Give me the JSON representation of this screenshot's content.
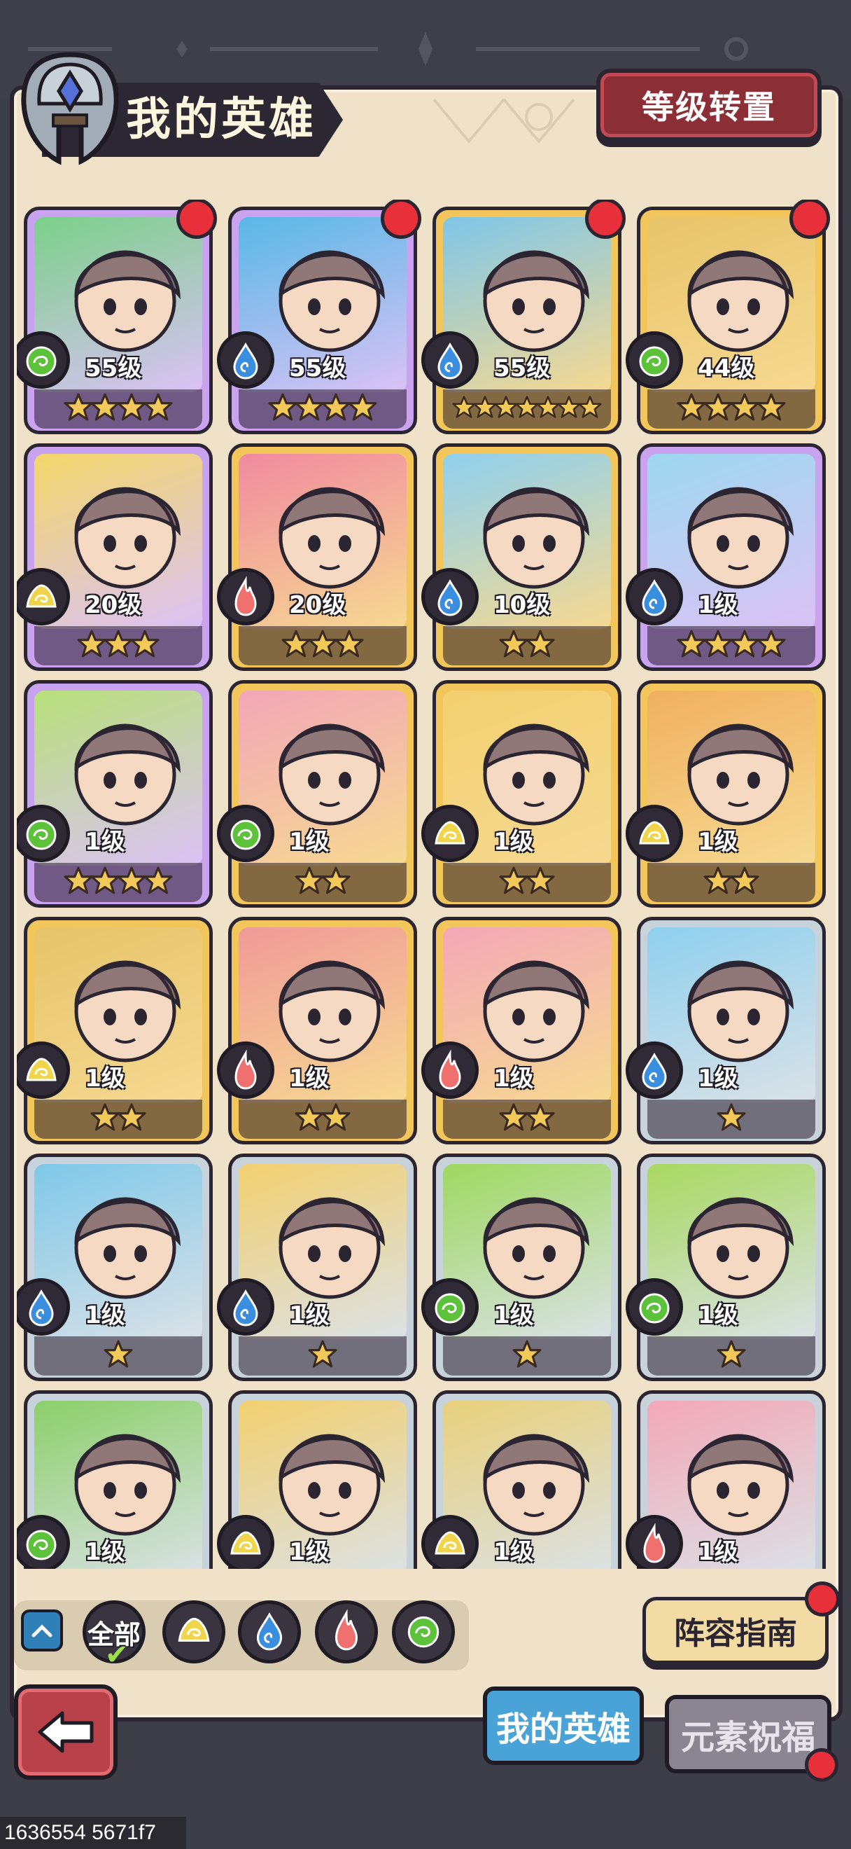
{
  "header": {
    "title": "我的英雄",
    "level_transfer_label": "等级转置"
  },
  "heroes": [
    {
      "level": "55级",
      "stars": 4,
      "element": "nature",
      "frame": "purple",
      "portrait": "#7bd08a",
      "has_badge": true
    },
    {
      "level": "55级",
      "stars": 4,
      "element": "water",
      "frame": "purple",
      "portrait": "#58b8e6",
      "has_badge": true
    },
    {
      "level": "55级",
      "stars": 7,
      "element": "water",
      "frame": "gold",
      "portrait": "#7fc6e8",
      "has_badge": true
    },
    {
      "level": "44级",
      "stars": 4,
      "element": "nature",
      "frame": "gold",
      "portrait": "#e8c46a",
      "has_badge": true
    },
    {
      "level": "20级",
      "stars": 3,
      "element": "earth",
      "frame": "purple",
      "portrait": "#f2d76a",
      "has_badge": false
    },
    {
      "level": "20级",
      "stars": 3,
      "element": "fire",
      "frame": "gold",
      "portrait": "#f08aa0",
      "has_badge": false
    },
    {
      "level": "10级",
      "stars": 2,
      "element": "water",
      "frame": "gold",
      "portrait": "#8fd0ee",
      "has_badge": false
    },
    {
      "level": "1级",
      "stars": 4,
      "element": "water",
      "frame": "purple",
      "portrait": "#9ed8f0",
      "has_badge": false
    },
    {
      "level": "1级",
      "stars": 4,
      "element": "nature",
      "frame": "purple",
      "portrait": "#b8e07a",
      "has_badge": false
    },
    {
      "level": "1级",
      "stars": 2,
      "element": "nature",
      "frame": "gold",
      "portrait": "#f2a7b8",
      "has_badge": false
    },
    {
      "level": "1级",
      "stars": 2,
      "element": "earth",
      "frame": "gold",
      "portrait": "#f2d070",
      "has_badge": false
    },
    {
      "level": "1级",
      "stars": 2,
      "element": "earth",
      "frame": "gold",
      "portrait": "#f0b060",
      "has_badge": false
    },
    {
      "level": "1级",
      "stars": 2,
      "element": "earth",
      "frame": "gold",
      "portrait": "#e6c46a",
      "has_badge": false
    },
    {
      "level": "1级",
      "stars": 2,
      "element": "fire",
      "frame": "gold",
      "portrait": "#f09a98",
      "has_badge": false
    },
    {
      "level": "1级",
      "stars": 2,
      "element": "fire",
      "frame": "gold",
      "portrait": "#f3a8b8",
      "has_badge": false
    },
    {
      "level": "1级",
      "stars": 1,
      "element": "water",
      "frame": "silver",
      "portrait": "#8fd0ee",
      "has_badge": false
    },
    {
      "level": "1级",
      "stars": 1,
      "element": "water",
      "frame": "silver",
      "portrait": "#7fc8e8",
      "has_badge": false
    },
    {
      "level": "1级",
      "stars": 1,
      "element": "water",
      "frame": "silver",
      "portrait": "#f2d070",
      "has_badge": false
    },
    {
      "level": "1级",
      "stars": 1,
      "element": "nature",
      "frame": "silver",
      "portrait": "#9ed860",
      "has_badge": false
    },
    {
      "level": "1级",
      "stars": 1,
      "element": "nature",
      "frame": "silver",
      "portrait": "#a8d860",
      "has_badge": false
    },
    {
      "level": "1级",
      "stars": 0,
      "element": "nature",
      "frame": "silver",
      "portrait": "#8ccf6a",
      "has_badge": false
    },
    {
      "level": "1级",
      "stars": 0,
      "element": "earth",
      "frame": "silver",
      "portrait": "#f2d070",
      "has_badge": false
    },
    {
      "level": "1级",
      "stars": 0,
      "element": "earth",
      "frame": "silver",
      "portrait": "#e8d07a",
      "has_badge": false
    },
    {
      "level": "1级",
      "stars": 0,
      "element": "fire",
      "frame": "silver",
      "portrait": "#f3a8b8",
      "has_badge": false
    }
  ],
  "filters": {
    "all_label": "全部",
    "elements": [
      "earth",
      "water",
      "fire",
      "nature"
    ]
  },
  "buttons": {
    "guide_label": "阵容指南"
  },
  "tabs": {
    "my_heroes": "我的英雄",
    "element_blessing": "元素祝福"
  },
  "footer": {
    "debug_text": "1636554 5671f7"
  },
  "colors": {
    "panel": "#efe2c8",
    "badge": "#e8303a",
    "earth": "#f0d44a",
    "water": "#3a8ee0",
    "fire": "#f07070",
    "nature": "#5cc23a",
    "frame_purple": "#c9a3f0",
    "frame_gold": "#f2c65a",
    "frame_silver": "#c8d2da"
  }
}
